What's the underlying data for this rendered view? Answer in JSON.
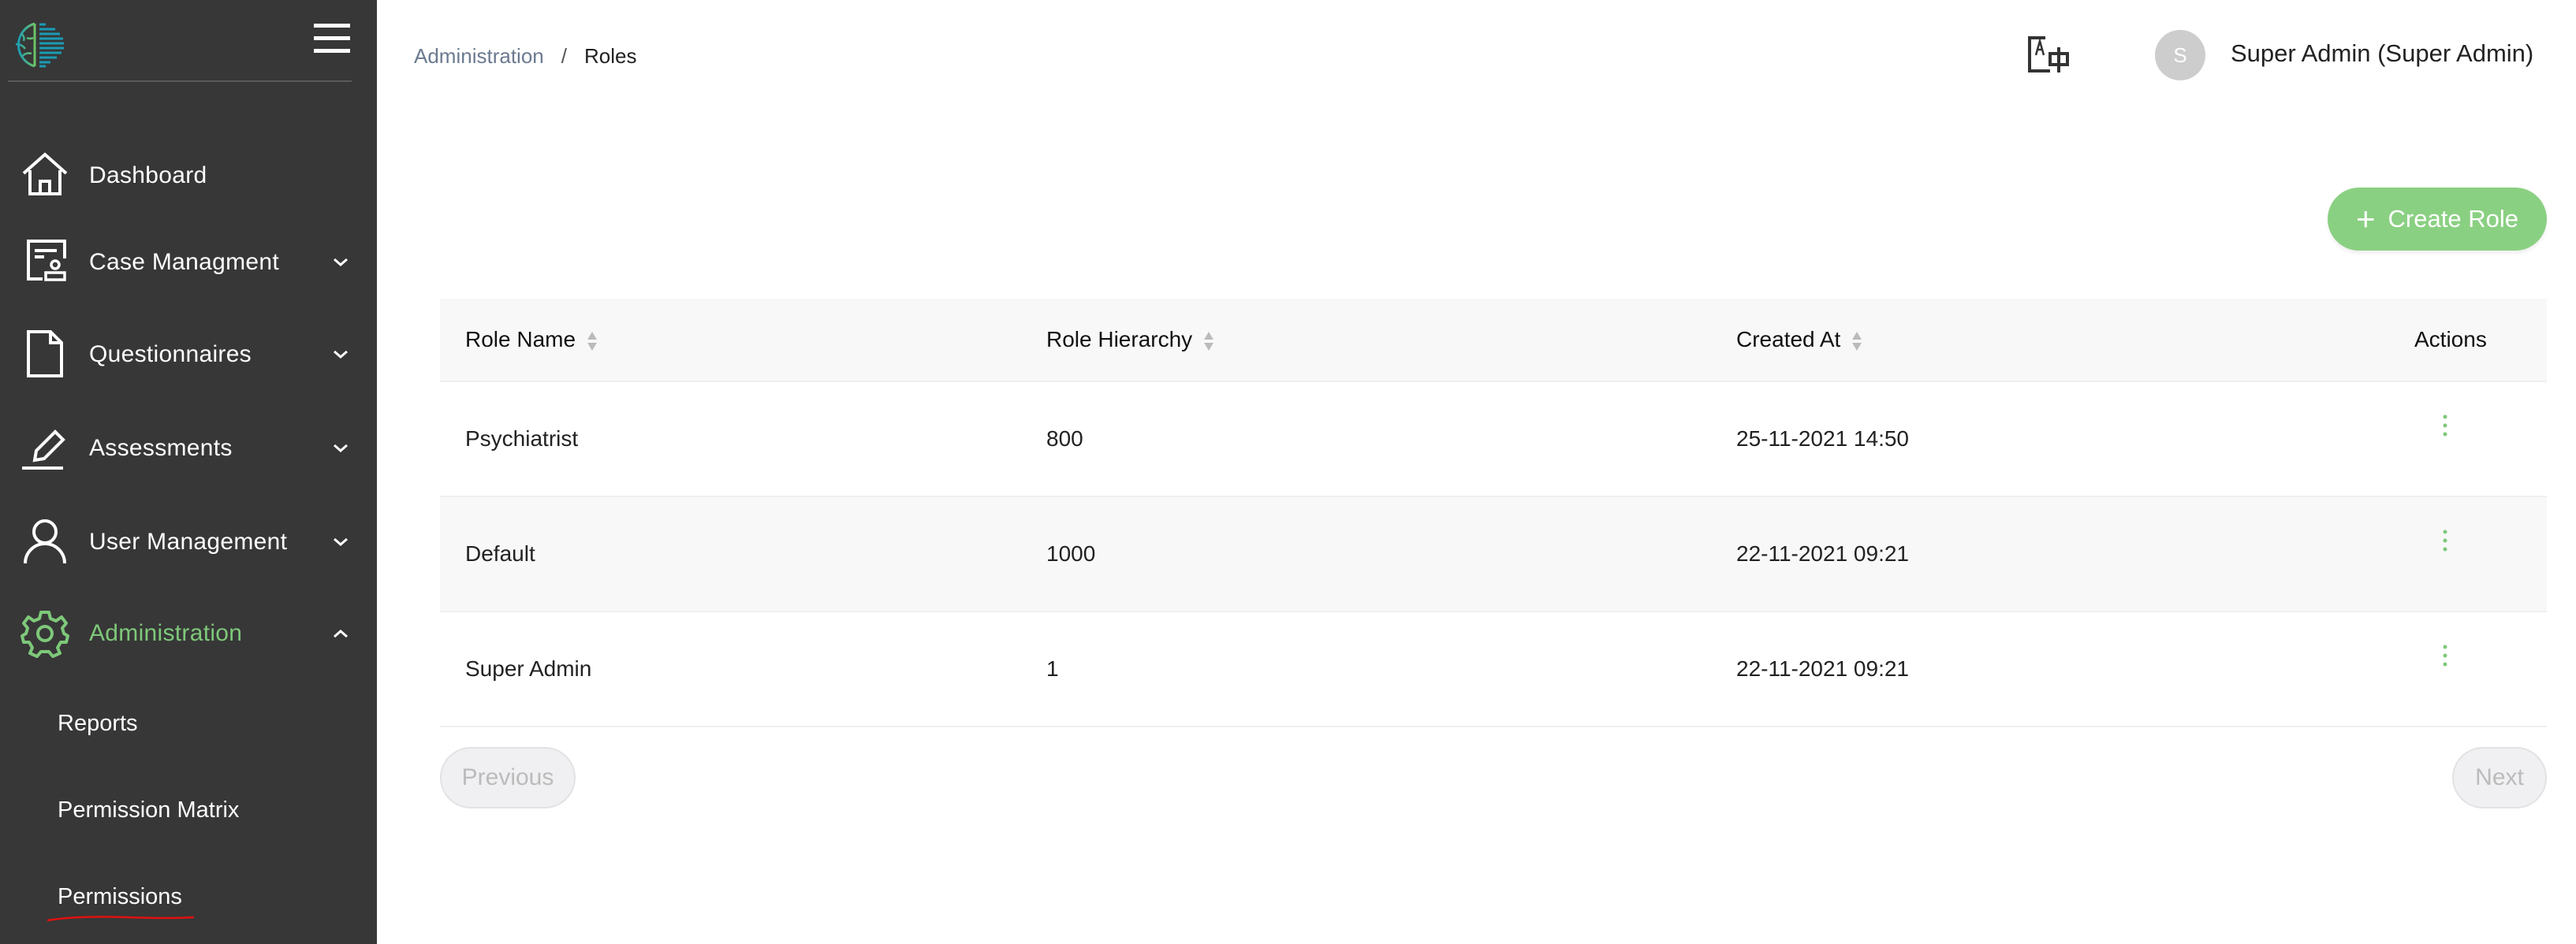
{
  "sidebar": {
    "items": [
      {
        "label": "Dashboard",
        "icon": "home-icon"
      },
      {
        "label": "Case Managment",
        "icon": "case-icon"
      },
      {
        "label": "Questionnaires",
        "icon": "document-icon"
      },
      {
        "label": "Assessments",
        "icon": "pencil-icon"
      },
      {
        "label": "User Management",
        "icon": "user-icon"
      },
      {
        "label": "Administration",
        "icon": "gear-icon"
      }
    ],
    "sub_items": [
      "Reports",
      "Permission Matrix",
      "Permissions"
    ],
    "active_color": "#7ec87a"
  },
  "header": {
    "breadcrumb": [
      "Administration",
      "Roles"
    ],
    "breadcrumb_sep": "/",
    "avatar_initial": "S",
    "user_name": "Super Admin (Super Admin)"
  },
  "toolbar": {
    "create_label": "Create Role",
    "create_icon": "+",
    "accent": "#8ad082"
  },
  "table": {
    "columns": [
      "Role Name",
      "Role Hierarchy",
      "Created At",
      "Actions"
    ],
    "rows": [
      {
        "name": "Psychiatrist",
        "hierarchy": "800",
        "created": "25-11-2021 14:50"
      },
      {
        "name": "Default",
        "hierarchy": "1000",
        "created": "22-11-2021 09:21"
      },
      {
        "name": "Super Admin",
        "hierarchy": "1",
        "created": "22-11-2021 09:21"
      }
    ]
  },
  "pagination": {
    "previous": "Previous",
    "next": "Next"
  }
}
